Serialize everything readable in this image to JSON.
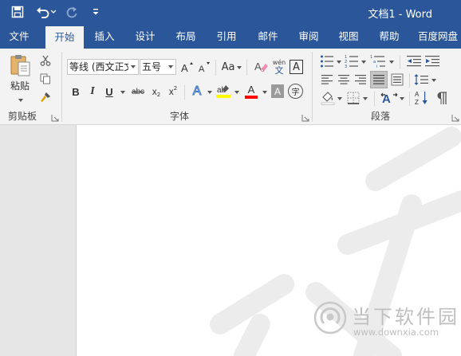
{
  "titlebar": {
    "title": "文档1 - Word",
    "qat": {
      "save_icon": "save-icon",
      "undo_icon": "undo-icon",
      "redo_icon": "redo-icon",
      "customize_icon": "customize-qat-icon"
    }
  },
  "tabs": [
    {
      "label": "文件"
    },
    {
      "label": "开始",
      "active": true
    },
    {
      "label": "插入"
    },
    {
      "label": "设计"
    },
    {
      "label": "布局"
    },
    {
      "label": "引用"
    },
    {
      "label": "邮件"
    },
    {
      "label": "审阅"
    },
    {
      "label": "视图"
    },
    {
      "label": "帮助"
    },
    {
      "label": "百度网盘"
    }
  ],
  "ribbon": {
    "clipboard": {
      "label": "剪贴板",
      "paste_label": "粘贴"
    },
    "font": {
      "label": "字体",
      "font_name": "等线 (西文正文)",
      "font_size": "五号",
      "change_case": "Aa",
      "phonetic_top": "wén",
      "phonetic_bottom": "文",
      "char_border": "A",
      "bold": "B",
      "italic": "I",
      "underline": "U",
      "strike": "abc",
      "subscript": "x",
      "subscript_mark": "2",
      "superscript": "x",
      "superscript_mark": "2",
      "text_effects": "A",
      "font_color": "A",
      "char_shading": "A",
      "enclose": "字"
    },
    "paragraph": {
      "label": "段落"
    }
  },
  "watermark": {
    "brand": "当下软件园",
    "url": "www.downxia.com"
  },
  "colors": {
    "titlebar": "#2b579a",
    "ribbon": "#f3f3f3",
    "highlight": "#ffff00",
    "font_color": "#ff0000"
  }
}
